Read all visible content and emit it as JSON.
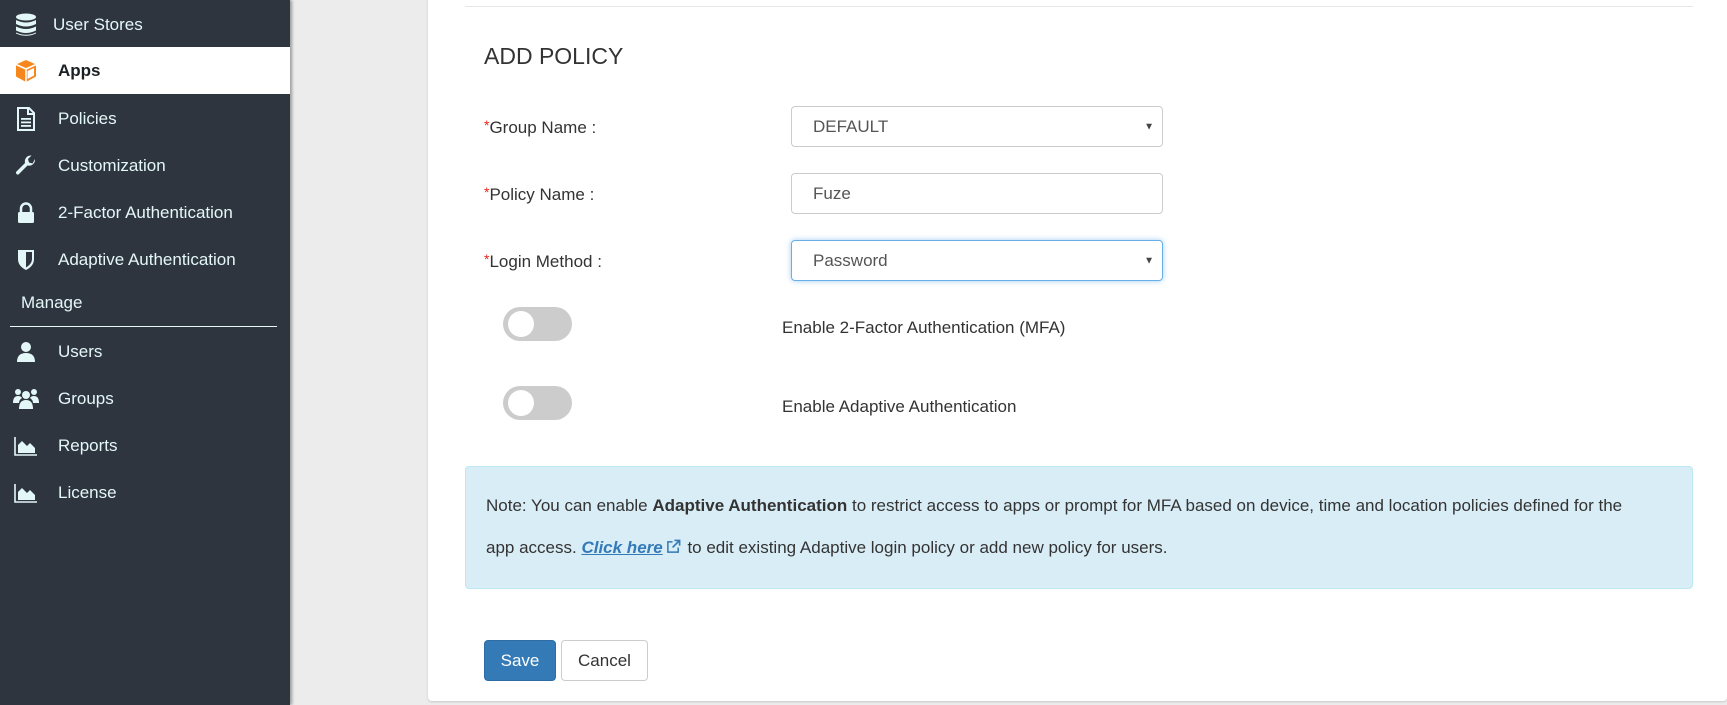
{
  "sidebar": {
    "items": [
      {
        "label": "User Stores",
        "icon": "database-icon",
        "active": false
      },
      {
        "label": "Apps",
        "icon": "cube-icon",
        "active": true
      },
      {
        "label": "Policies",
        "icon": "document-icon",
        "active": false
      },
      {
        "label": "Customization",
        "icon": "wrench-icon",
        "active": false
      },
      {
        "label": "2-Factor Authentication",
        "icon": "lock-icon",
        "active": false
      },
      {
        "label": "Adaptive Authentication",
        "icon": "shield-icon",
        "active": false
      }
    ],
    "section_label": "Manage",
    "manage_items": [
      {
        "label": "Users",
        "icon": "user-icon"
      },
      {
        "label": "Groups",
        "icon": "users-group-icon"
      },
      {
        "label": "Reports",
        "icon": "area-chart-icon"
      },
      {
        "label": "License",
        "icon": "area-chart-icon"
      }
    ]
  },
  "form": {
    "title": "ADD POLICY",
    "required_marker": "*",
    "group_name": {
      "label": "Group Name :",
      "value": "DEFAULT"
    },
    "policy_name": {
      "label": "Policy Name :",
      "value": "Fuze"
    },
    "login_method": {
      "label": "Login Method :",
      "value": "Password"
    },
    "caret": "▼",
    "toggles": [
      {
        "label": "Enable 2-Factor Authentication (MFA)",
        "enabled": false
      },
      {
        "label": "Enable Adaptive Authentication",
        "enabled": false
      }
    ]
  },
  "note": {
    "prefix": "Note: You can enable ",
    "bold": "Adaptive Authentication",
    "middle": " to restrict access to apps or prompt for MFA based on device, time and location policies defined for the",
    "line2_prefix": "app access. ",
    "link": "Click here",
    "suffix": " to edit existing Adaptive login policy or add new policy for users."
  },
  "buttons": {
    "save": "Save",
    "cancel": "Cancel"
  },
  "colors": {
    "sidebar_bg": "#2e353e",
    "accent_orange": "#f7861c",
    "primary": "#337ab7",
    "note_bg": "#d9edf7",
    "required": "#e3241b"
  }
}
